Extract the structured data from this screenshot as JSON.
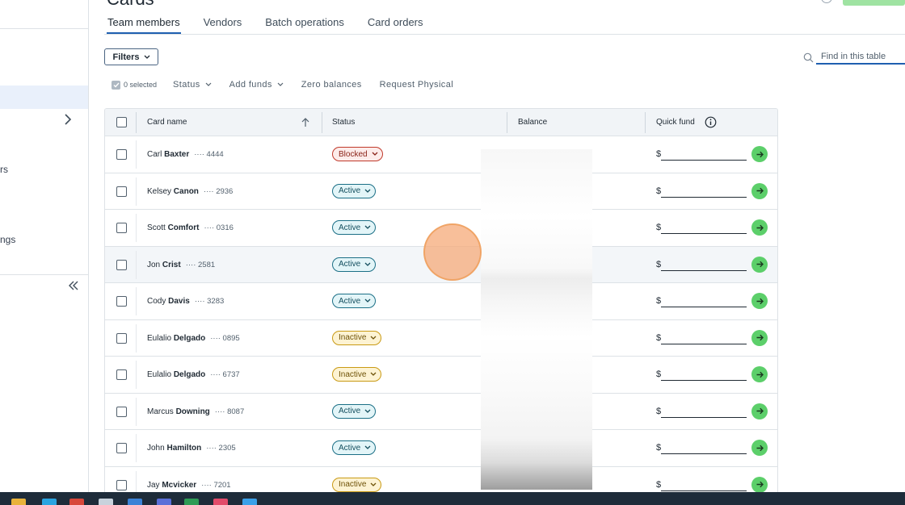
{
  "page": {
    "title_fragment": "Cards"
  },
  "sidebar": {
    "fragments": [
      "rs",
      "ngs"
    ]
  },
  "tabs": [
    "Team members",
    "Vendors",
    "Batch operations",
    "Card orders"
  ],
  "filters": {
    "label": "Filters"
  },
  "search": {
    "placeholder": "Find in this table"
  },
  "bulk": {
    "selected": "0 selected",
    "actions": [
      "Status",
      "Add funds",
      "Zero balances",
      "Request Physical"
    ]
  },
  "table": {
    "columns": [
      "Card name",
      "Status",
      "Balance",
      "Quick fund"
    ],
    "currency": "$",
    "rows": [
      {
        "first": "Carl",
        "last": "Baxter",
        "digits": "···· 4444",
        "status": "Blocked"
      },
      {
        "first": "Kelsey",
        "last": "Canon",
        "digits": "···· 2936",
        "status": "Active"
      },
      {
        "first": "Scott",
        "last": "Comfort",
        "digits": "···· 0316",
        "status": "Active"
      },
      {
        "first": "Jon",
        "last": "Crist",
        "digits": "···· 2581",
        "status": "Active"
      },
      {
        "first": "Cody",
        "last": "Davis",
        "digits": "···· 3283",
        "status": "Active"
      },
      {
        "first": "Eulalio",
        "last": "Delgado",
        "digits": "···· 0895",
        "status": "Inactive"
      },
      {
        "first": "Eulalio",
        "last": "Delgado",
        "digits": "···· 6737",
        "status": "Inactive"
      },
      {
        "first": "Marcus",
        "last": "Downing",
        "digits": "···· 8087",
        "status": "Active"
      },
      {
        "first": "John",
        "last": "Hamilton",
        "digits": "···· 2305",
        "status": "Active"
      },
      {
        "first": "Jay",
        "last": "Mcvicker",
        "digits": "···· 7201",
        "status": "Inactive"
      }
    ]
  },
  "colors": {
    "accent": "#1f5fb0",
    "go": "#5ccf6a",
    "blocked": "#c0392b",
    "active": "#1b6f86",
    "inactive": "#c99a14",
    "taskbar": "#1e2c3a"
  },
  "icons": [
    "chevron-right-icon",
    "collapse-double-left-icon",
    "chevron-down-icon",
    "search-icon",
    "sort-up-icon",
    "info-icon",
    "arrow-right-icon",
    "check-icon"
  ]
}
